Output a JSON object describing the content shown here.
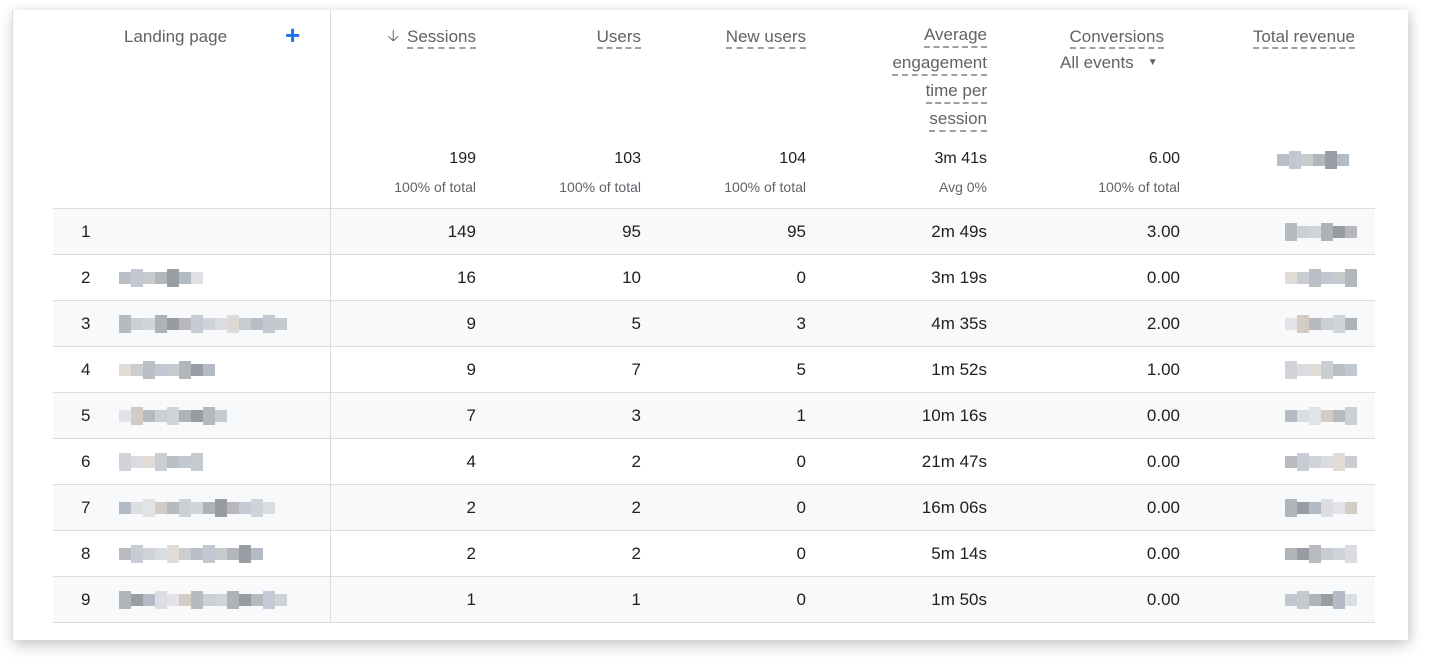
{
  "header": {
    "landing_page_label": "Landing page",
    "add_dimension_icon": "plus-icon",
    "sort_icon": "arrow-down-icon",
    "columns": [
      {
        "key": "sessions",
        "label": "Sessions",
        "sorted": "descending"
      },
      {
        "key": "users",
        "label": "Users"
      },
      {
        "key": "new_users",
        "label": "New users"
      },
      {
        "key": "avg_engagement",
        "label_lines": [
          "Average",
          "engagement",
          "time per",
          "session"
        ]
      },
      {
        "key": "conversions",
        "label": "Conversions",
        "dropdown": {
          "selected": "All events"
        }
      },
      {
        "key": "total_revenue",
        "label": "Total revenue"
      }
    ]
  },
  "totals": {
    "sessions": {
      "value": "199",
      "sub": "100% of total"
    },
    "users": {
      "value": "103",
      "sub": "100% of total"
    },
    "new_users": {
      "value": "104",
      "sub": "100% of total"
    },
    "avg_engagement": {
      "value": "3m 41s",
      "sub": "Avg 0%"
    },
    "conversions": {
      "value": "6.00",
      "sub": "100% of total"
    },
    "total_revenue": {
      "value": "[redacted]"
    }
  },
  "rows": [
    {
      "index": "1",
      "landing_page": "",
      "sessions": "149",
      "users": "95",
      "new_users": "95",
      "avg_engagement": "2m 49s",
      "conversions": "3.00",
      "total_revenue": "[redacted]"
    },
    {
      "index": "2",
      "landing_page": "[redacted]",
      "sessions": "16",
      "users": "10",
      "new_users": "0",
      "avg_engagement": "3m 19s",
      "conversions": "0.00",
      "total_revenue": "[redacted]"
    },
    {
      "index": "3",
      "landing_page": "[redacted]",
      "sessions": "9",
      "users": "5",
      "new_users": "3",
      "avg_engagement": "4m 35s",
      "conversions": "2.00",
      "total_revenue": "[redacted]"
    },
    {
      "index": "4",
      "landing_page": "[redacted]",
      "sessions": "9",
      "users": "7",
      "new_users": "5",
      "avg_engagement": "1m 52s",
      "conversions": "1.00",
      "total_revenue": "[redacted]"
    },
    {
      "index": "5",
      "landing_page": "[redacted]",
      "sessions": "7",
      "users": "3",
      "new_users": "1",
      "avg_engagement": "10m 16s",
      "conversions": "0.00",
      "total_revenue": "[redacted]"
    },
    {
      "index": "6",
      "landing_page": "[redacted]",
      "sessions": "4",
      "users": "2",
      "new_users": "0",
      "avg_engagement": "21m 47s",
      "conversions": "0.00",
      "total_revenue": "[redacted]"
    },
    {
      "index": "7",
      "landing_page": "[redacted]",
      "sessions": "2",
      "users": "2",
      "new_users": "0",
      "avg_engagement": "16m 06s",
      "conversions": "0.00",
      "total_revenue": "[redacted]"
    },
    {
      "index": "8",
      "landing_page": "[redacted]",
      "sessions": "2",
      "users": "2",
      "new_users": "0",
      "avg_engagement": "5m 14s",
      "conversions": "0.00",
      "total_revenue": "[redacted]"
    },
    {
      "index": "9",
      "landing_page": "[redacted]",
      "sessions": "1",
      "users": "1",
      "new_users": "0",
      "avg_engagement": "1m 50s",
      "conversions": "0.00",
      "total_revenue": "[redacted]"
    }
  ],
  "colors": {
    "accent": "#1a73e8",
    "row_shade": "#f8f9fa",
    "border": "#dadce0",
    "header_text": "#5f6368",
    "body_text": "#202124"
  }
}
